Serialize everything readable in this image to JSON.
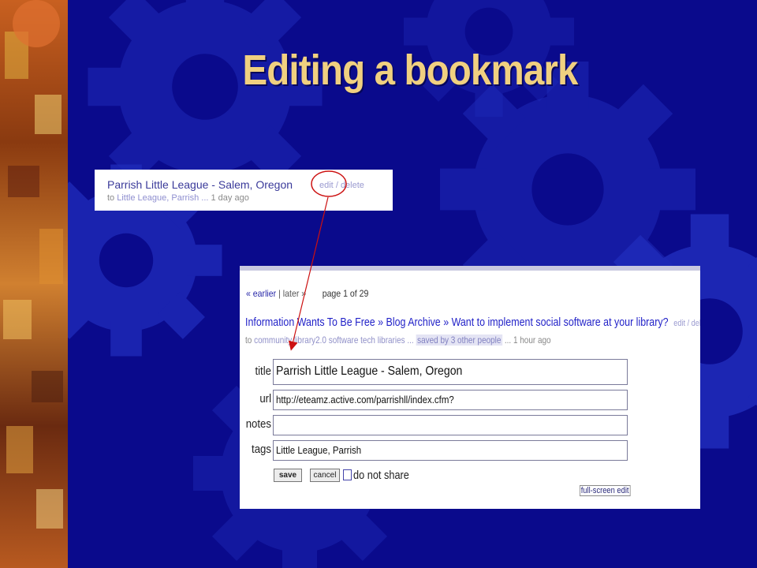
{
  "slide": {
    "title": "Editing a bookmark"
  },
  "bookmark_item": {
    "title": "Parrish Little League - Salem, Oregon",
    "edit_label": "edit",
    "separator": "/",
    "delete_label": "delete",
    "prefix": "to",
    "tags": "Little League, Parrish ...",
    "age": "1 day ago"
  },
  "edit_screen": {
    "nav": {
      "earlier": "« earlier",
      "sep": "|",
      "later": "later »",
      "page": "page 1 of 29"
    },
    "blog_item": {
      "title": "Information Wants To Be Free » Blog Archive » Want to implement social software at your library?",
      "edit_label": "edit",
      "separator": "/",
      "delete_label": "delete",
      "prefix": "to",
      "tags": "community library2.0 software tech libraries ...",
      "saved_by": "saved by 3 other people",
      "age": "... 1 hour ago"
    },
    "form": {
      "title_label": "title",
      "title_value": "Parrish Little League - Salem, Oregon",
      "url_label": "url",
      "url_value": "http://eteamz.active.com/parrishll/index.cfm?",
      "notes_label": "notes",
      "notes_value": "",
      "tags_label": "tags",
      "tags_value": "Little League, Parrish",
      "save_label": "save",
      "cancel_label": "cancel",
      "do_not_share_label": "do not share",
      "do_not_share_checked": false,
      "fullscreen_label": "full-screen edit"
    }
  },
  "colors": {
    "background": "#0a0a8c",
    "title": "#f0d080",
    "annotation": "#cc1111",
    "link": "#2222c8"
  }
}
